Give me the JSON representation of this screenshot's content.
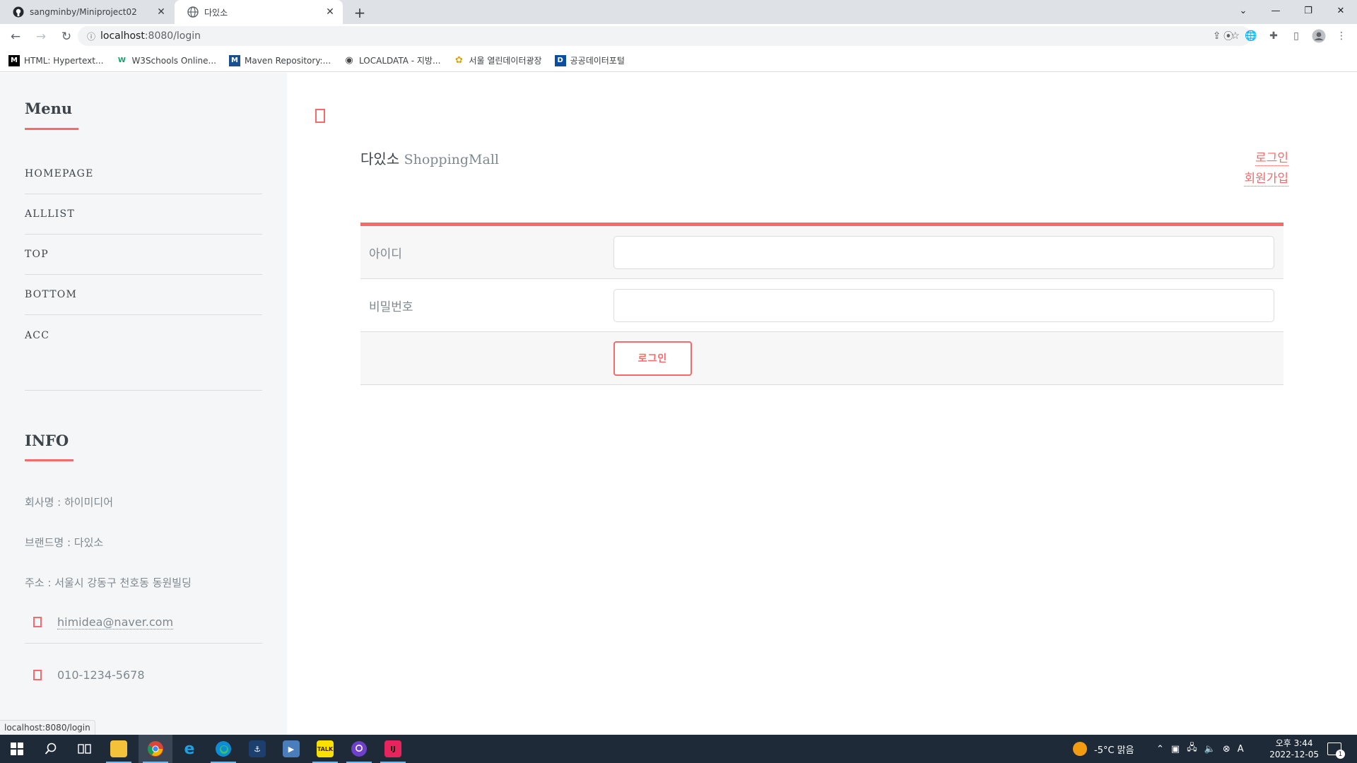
{
  "browser": {
    "tabs": [
      {
        "title": "sangminby/Miniproject02",
        "icon": "github-icon",
        "active": false
      },
      {
        "title": "다있소",
        "icon": "globe-icon",
        "active": true
      }
    ],
    "url_host": "localhost",
    "url_path": ":8080/login",
    "bookmarks": [
      {
        "label": "HTML: Hypertext...",
        "icon": "mdn-icon",
        "icon_text": "M",
        "color": "#000000"
      },
      {
        "label": "W3Schools Online...",
        "icon": "w3schools-icon",
        "icon_text": "W",
        "color": "#04aa6d"
      },
      {
        "label": "Maven Repository:...",
        "icon": "maven-icon",
        "icon_text": "M",
        "color": "#1a4f8b"
      },
      {
        "label": "LOCALDATA - 지방...",
        "icon": "globe-icon",
        "icon_text": "◉",
        "color": "#444444"
      },
      {
        "label": "서울 열린데이터광장",
        "icon": "seoul-icon",
        "icon_text": "✿",
        "color": "#e0a020"
      },
      {
        "label": "공공데이터포털",
        "icon": "data-portal-icon",
        "icon_text": "D",
        "color": "#0a4ea3"
      }
    ],
    "status_url": "localhost:8080/login"
  },
  "sidebar": {
    "menu_heading": "Menu",
    "menu_items": [
      "HOMEPAGE",
      "ALLLIST",
      "TOP",
      "BOTTOM",
      "ACC"
    ],
    "info_heading": "INFO",
    "info_lines": [
      "회사명 : 하이미디어",
      "브랜드명 : 다있소",
      "주소 : 서울시 강동구 천호동 동원빌딩"
    ],
    "email": "himidea@naver.com",
    "phone": "010-1234-5678"
  },
  "header": {
    "logo_main": "다있소",
    "logo_sub": "ShoppingMall",
    "login_link": "로그인",
    "signup_link": "회원가입"
  },
  "login_form": {
    "id_label": "아이디",
    "id_value": "",
    "password_label": "비밀번호",
    "password_value": "",
    "submit_label": "로그인"
  },
  "taskbar": {
    "weather": "-5°C  맑음",
    "time": "오후 3:44",
    "date": "2022-12-05",
    "notification_count": "1",
    "ime": "A"
  },
  "colors": {
    "accent": "#f56a6a",
    "sidebar_bg": "#f5f6f7",
    "taskbar_bg": "#1f2a38"
  }
}
